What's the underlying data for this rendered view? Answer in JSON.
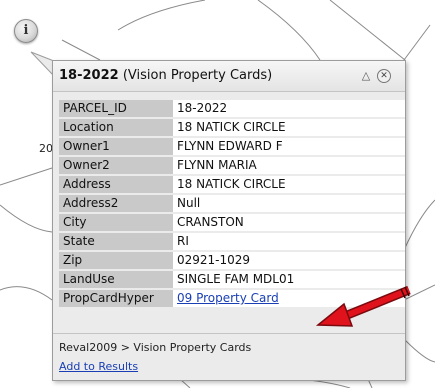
{
  "map": {
    "street_label": "20"
  },
  "marker": {
    "glyph": "i",
    "icon": "info-icon"
  },
  "popup": {
    "parcel_id": "18-2022",
    "layer_name": "(Vision Property Cards)",
    "collapse_glyph": "△",
    "close_glyph": "✕",
    "attributes": [
      {
        "key": "PARCEL_ID",
        "value": "18-2022"
      },
      {
        "key": "Location",
        "value": "18 NATICK CIRCLE"
      },
      {
        "key": "Owner1",
        "value": "FLYNN EDWARD F"
      },
      {
        "key": "Owner2",
        "value": "FLYNN MARIA"
      },
      {
        "key": "Address",
        "value": "18 NATICK CIRCLE"
      },
      {
        "key": "Address2",
        "value": "Null"
      },
      {
        "key": "City",
        "value": "CRANSTON"
      },
      {
        "key": "State",
        "value": "RI"
      },
      {
        "key": "Zip",
        "value": "02921-1029"
      },
      {
        "key": "LandUse",
        "value": "SINGLE FAM MDL01"
      },
      {
        "key": "PropCardHyper",
        "value": "09 Property Card"
      }
    ],
    "footer_path": "Reval2009 > Vision Property Cards",
    "add_to_results": "Add to Results"
  },
  "colors": {
    "link": "#1a3fb5",
    "annotation_arrow": "#e0121b",
    "key_cell": "#c9c9c9"
  }
}
